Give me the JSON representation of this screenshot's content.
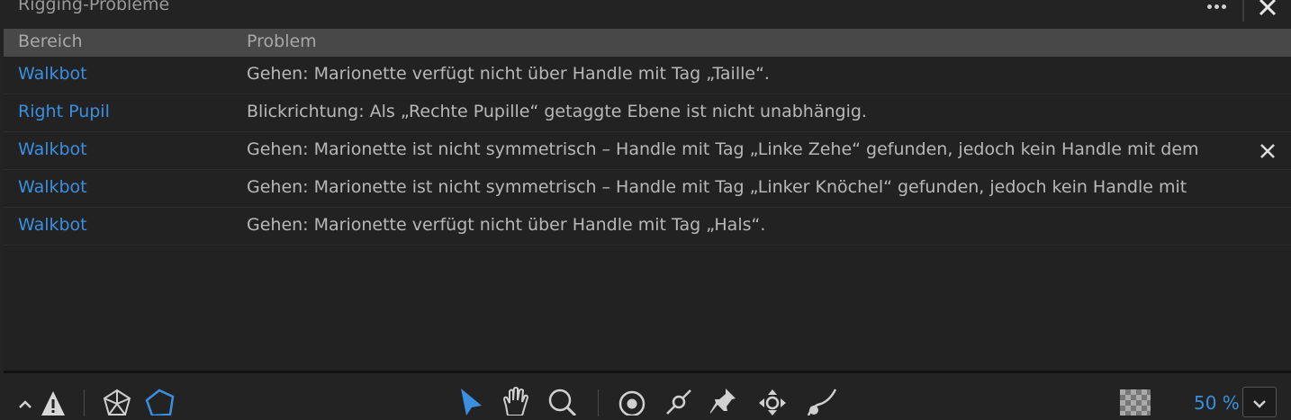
{
  "panel": {
    "title": "Rigging-Probleme"
  },
  "table": {
    "columns": [
      "Bereich",
      "Problem"
    ],
    "rows": [
      {
        "area": "Walkbot",
        "problem": "Gehen: Marionette verfügt nicht über Handle mit Tag „Taille“."
      },
      {
        "area": "Right Pupil",
        "problem": "Blickrichtung: Als „Rechte Pupille“ getaggte Ebene ist nicht unabhängig."
      },
      {
        "area": "Walkbot",
        "problem": "Gehen: Marionette ist nicht symmetrisch – Handle mit Tag „Linke Zehe“ gefunden, jedoch kein Handle mit dem"
      },
      {
        "area": "Walkbot",
        "problem": "Gehen: Marionette ist nicht symmetrisch – Handle mit Tag „Linker Knöchel“ gefunden, jedoch kein Handle mit"
      },
      {
        "area": "Walkbot",
        "problem": "Gehen: Marionette verfügt nicht über Handle mit Tag „Hals“."
      }
    ]
  },
  "toolbar": {
    "zoom": "50 %",
    "icons": [
      "chevron-up-icon",
      "warning-icon",
      "mesh-icon",
      "polygon-icon",
      "select-arrow-icon",
      "hand-icon",
      "zoom-icon",
      "origin-icon",
      "stick-icon",
      "pin-icon",
      "dragger-icon",
      "curve-icon",
      "transparency-grid-icon",
      "chevron-down-icon"
    ]
  },
  "colors": {
    "accent": "#3a8fe0",
    "background": "#232323",
    "header_row": "#484848"
  }
}
